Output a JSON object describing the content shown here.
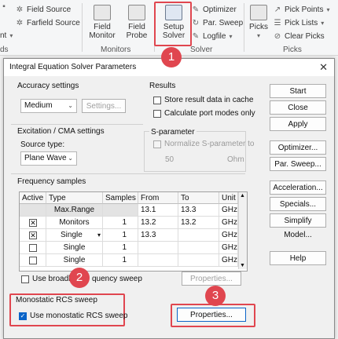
{
  "ribbon": {
    "field_source": "Field Source",
    "farfield_source": "Farfield Source",
    "field_monitor": "Field Monitor",
    "field_probe": "Field Probe",
    "setup_solver": "Setup Solver",
    "optimizer": "Optimizer",
    "par_sweep": "Par. Sweep",
    "logfile": "Logfile",
    "picks": "Picks",
    "pick_points": "Pick Points",
    "pick_lists": "Pick Lists",
    "clear_picks": "Clear Picks",
    "groups": {
      "left_partial": "ds",
      "monitors": "Monitors",
      "solver": "Solver",
      "picks": "Picks"
    },
    "left_partial_label": "nt"
  },
  "badges": [
    "1",
    "2",
    "3"
  ],
  "dialog": {
    "title": "Integral Equation Solver Parameters",
    "accuracy": {
      "title": "Accuracy settings",
      "value": "Medium",
      "settings_btn": "Settings..."
    },
    "results": {
      "title": "Results",
      "store": "Store result data in cache",
      "calc_port": "Calculate port modes only"
    },
    "excitation": {
      "title": "Excitation / CMA settings",
      "source_label": "Source type:",
      "source_value": "Plane Wave"
    },
    "sparam": {
      "title": "S-parameter",
      "normalize": "Normalize S-parameter to",
      "value": "50",
      "unit": "Ohm"
    },
    "freq": {
      "title": "Frequency samples",
      "headers": [
        "Active",
        "Type",
        "Samples",
        "From",
        "To",
        "Unit"
      ],
      "rows": [
        {
          "type": "Max.Range",
          "samples": "",
          "from": "13.1",
          "to": "13.3",
          "unit": "GHz"
        },
        {
          "type": "Monitors",
          "samples": "1",
          "from": "13.2",
          "to": "13.2",
          "unit": "GHz"
        },
        {
          "type": "Single",
          "samples": "1",
          "from": "13.3",
          "to": "",
          "unit": "GHz"
        },
        {
          "type": "Single",
          "samples": "1",
          "from": "",
          "to": "",
          "unit": "GHz"
        },
        {
          "type": "Single",
          "samples": "1",
          "from": "",
          "to": "",
          "unit": "GHz"
        }
      ],
      "broadband_a": "Use broadba",
      "broadband_b": "quency sweep",
      "properties_btn": "Properties..."
    },
    "monostatic": {
      "title": "Monostatic RCS sweep",
      "use": "Use monostatic RCS sweep",
      "properties_btn": "Properties..."
    },
    "buttons": {
      "start": "Start",
      "close": "Close",
      "apply": "Apply",
      "optimizer": "Optimizer...",
      "par_sweep": "Par. Sweep...",
      "acceleration": "Acceleration...",
      "specials": "Specials...",
      "simplify": "Simplify Model...",
      "help": "Help"
    }
  },
  "colors": {
    "highlight": "#e0464f",
    "accent": "#0a64c8"
  }
}
